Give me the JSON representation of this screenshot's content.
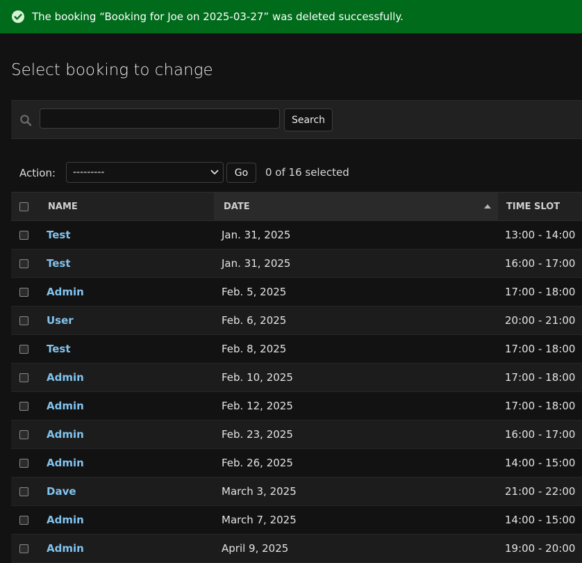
{
  "banner": {
    "message": "The booking “Booking for Joe on 2025-03-27” was deleted successfully."
  },
  "page": {
    "title": "Select booking to change"
  },
  "search": {
    "value": "",
    "button_label": "Search"
  },
  "actions": {
    "label": "Action:",
    "selected_value": "---------",
    "go_label": "Go",
    "counter": "0 of 16 selected"
  },
  "table": {
    "headers": {
      "name": "NAME",
      "date": "DATE",
      "time_slot": "TIME SLOT"
    },
    "rows": [
      {
        "name": "Test",
        "date": "Jan. 31, 2025",
        "time_slot": "13:00 - 14:00"
      },
      {
        "name": "Test",
        "date": "Jan. 31, 2025",
        "time_slot": "16:00 - 17:00"
      },
      {
        "name": "Admin",
        "date": "Feb. 5, 2025",
        "time_slot": "17:00 - 18:00"
      },
      {
        "name": "User",
        "date": "Feb. 6, 2025",
        "time_slot": "20:00 - 21:00"
      },
      {
        "name": "Test",
        "date": "Feb. 8, 2025",
        "time_slot": "17:00 - 18:00"
      },
      {
        "name": "Admin",
        "date": "Feb. 10, 2025",
        "time_slot": "17:00 - 18:00"
      },
      {
        "name": "Admin",
        "date": "Feb. 12, 2025",
        "time_slot": "17:00 - 18:00"
      },
      {
        "name": "Admin",
        "date": "Feb. 23, 2025",
        "time_slot": "16:00 - 17:00"
      },
      {
        "name": "Admin",
        "date": "Feb. 26, 2025",
        "time_slot": "14:00 - 15:00"
      },
      {
        "name": "Dave",
        "date": "March 3, 2025",
        "time_slot": "21:00 - 22:00"
      },
      {
        "name": "Admin",
        "date": "March 7, 2025",
        "time_slot": "14:00 - 15:00"
      },
      {
        "name": "Admin",
        "date": "April 9, 2025",
        "time_slot": "19:00 - 20:00"
      }
    ]
  },
  "colors": {
    "success": "#006b1b",
    "link": "#81c3ee",
    "background": "#121212",
    "toolbar": "#212121"
  },
  "icons": {
    "banner": "check-circle-icon",
    "search": "search-icon",
    "select": "chevron-down-icon",
    "sort": "sort-ascending-icon"
  }
}
